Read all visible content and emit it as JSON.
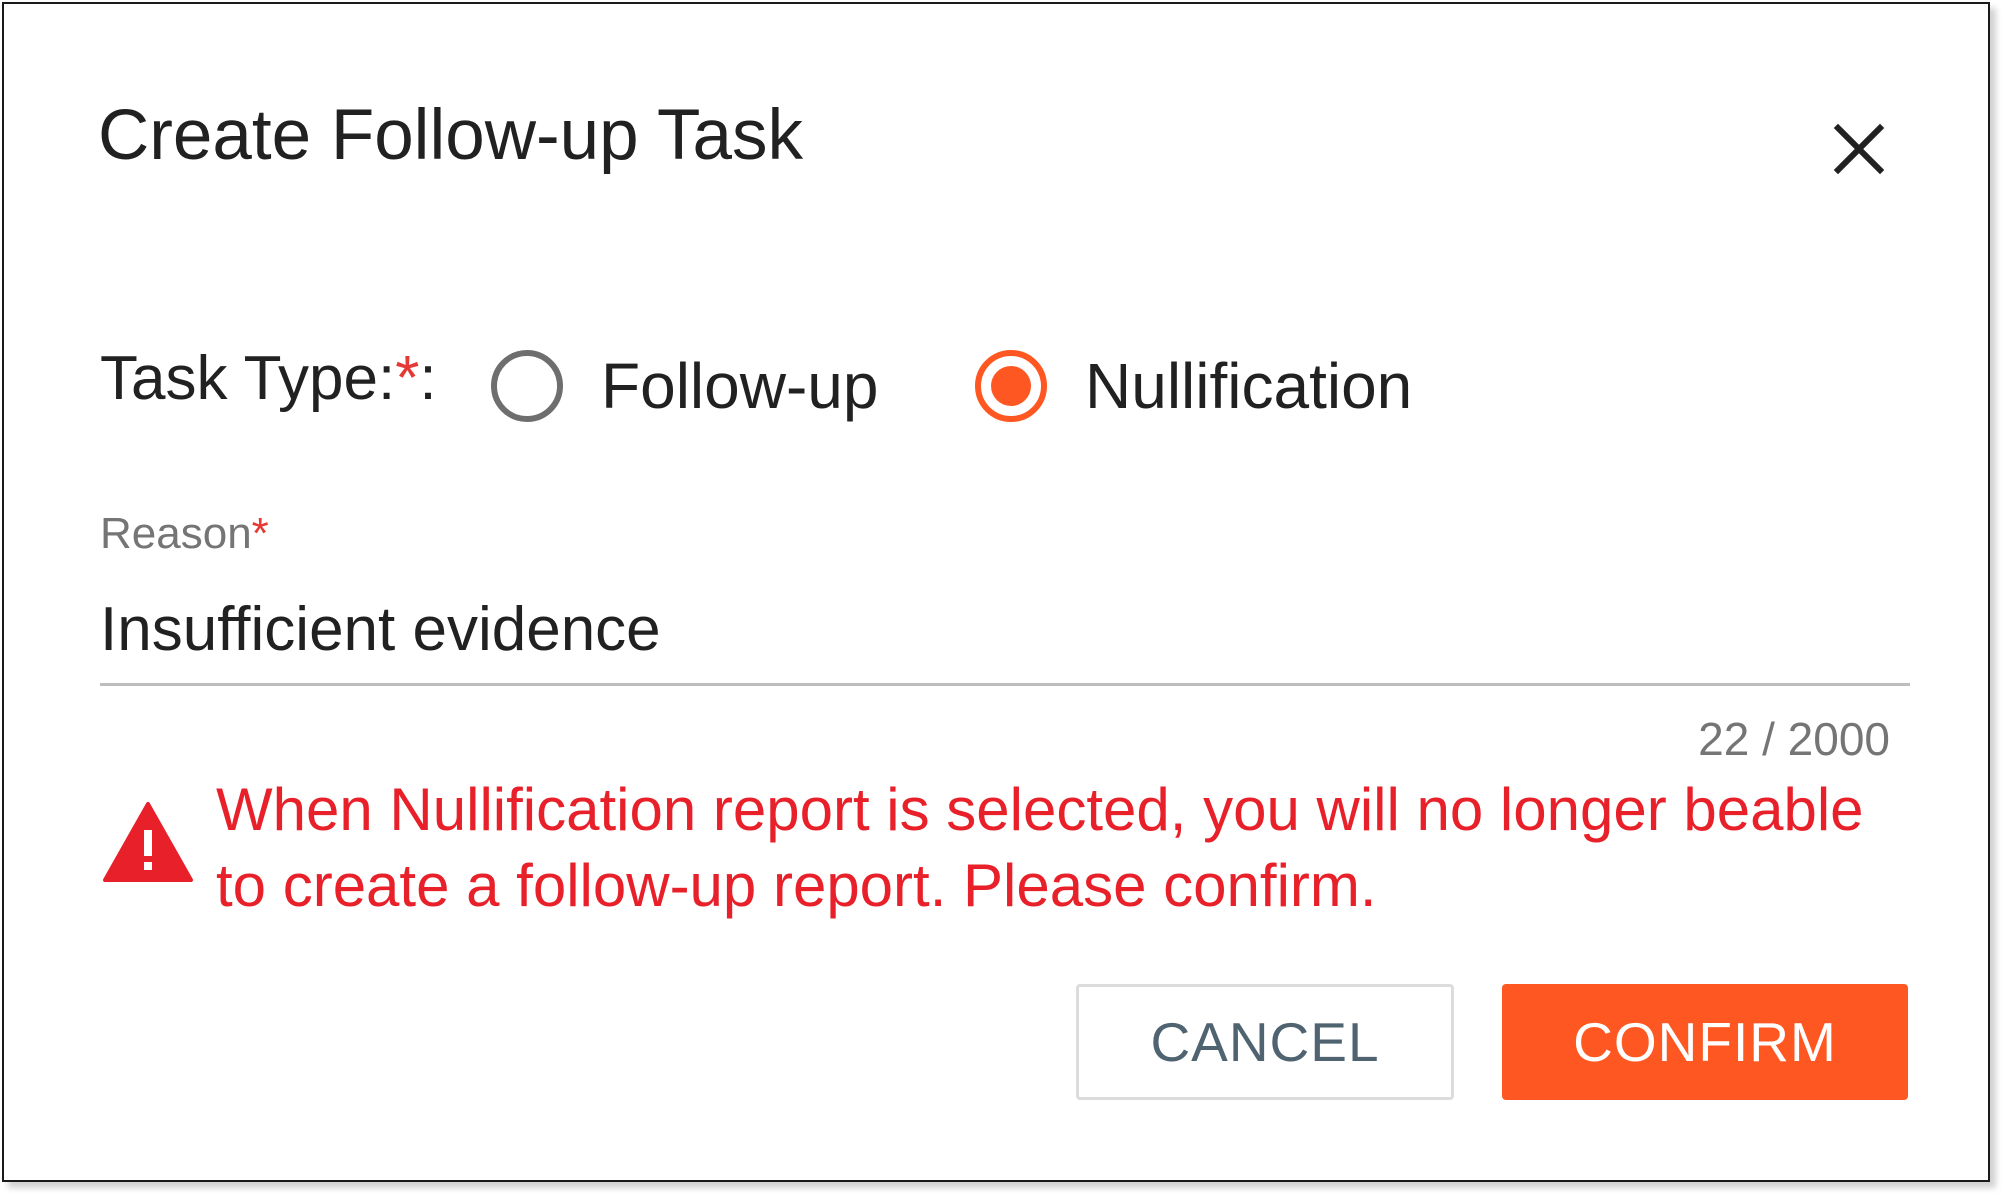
{
  "dialog": {
    "title": "Create Follow-up Task"
  },
  "task_type": {
    "label": "Task Type:",
    "required_mark": "*",
    "suffix": ":",
    "options": [
      {
        "label": "Follow-up",
        "selected": false
      },
      {
        "label": "Nullification",
        "selected": true
      }
    ]
  },
  "reason": {
    "label": "Reason",
    "required_mark": "*",
    "value": "Insufficient evidence",
    "counter": "22 / 2000"
  },
  "warning": {
    "text": "When Nullification report is selected, you will no longer beable to create a follow-up report. Please confirm."
  },
  "actions": {
    "cancel_label": "CANCEL",
    "confirm_label": "CONFIRM"
  },
  "icons": {
    "close": "close-icon",
    "warning": "warning-triangle-icon"
  },
  "colors": {
    "accent": "#ff5722",
    "error": "#e8202a",
    "required": "#e53935"
  }
}
